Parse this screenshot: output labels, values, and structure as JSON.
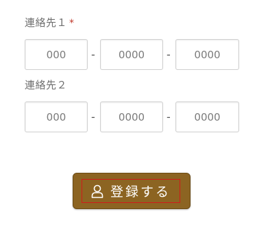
{
  "contact1": {
    "label": "連絡先１",
    "required_mark": "*",
    "fields": [
      {
        "placeholder": "000"
      },
      {
        "placeholder": "0000"
      },
      {
        "placeholder": "0000"
      }
    ],
    "separator": "-"
  },
  "contact2": {
    "label": "連絡先２",
    "fields": [
      {
        "placeholder": "000"
      },
      {
        "placeholder": "0000"
      },
      {
        "placeholder": "0000"
      }
    ],
    "separator": "-"
  },
  "submit": {
    "label": "登録する",
    "icon": "user-icon",
    "bg_color": "#8c6422",
    "focus_color": "#d11a1a"
  }
}
